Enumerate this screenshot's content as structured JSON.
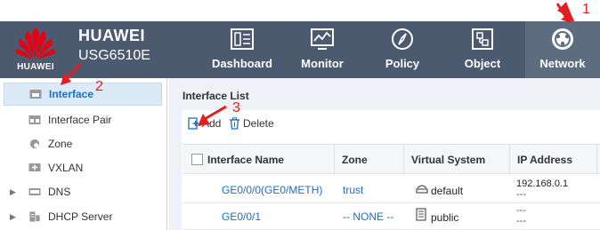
{
  "header": {
    "logo_text": "HUAWEI",
    "brand": "HUAWEI",
    "model": "USG6510E",
    "nav": [
      {
        "label": "Dashboard",
        "icon": "dashboard-icon"
      },
      {
        "label": "Monitor",
        "icon": "monitor-icon"
      },
      {
        "label": "Policy",
        "icon": "compass-icon"
      },
      {
        "label": "Object",
        "icon": "object-icon"
      },
      {
        "label": "Network",
        "icon": "globe-icon",
        "active": true
      }
    ]
  },
  "sidebar": {
    "items": [
      {
        "label": "Interface",
        "icon": "interface-icon",
        "active": true
      },
      {
        "label": "Interface Pair",
        "icon": "interface-pair-icon"
      },
      {
        "label": "Zone",
        "icon": "zone-icon"
      },
      {
        "label": "VXLAN",
        "icon": "vxlan-icon"
      },
      {
        "label": "DNS",
        "icon": "dns-icon",
        "expandable": true
      },
      {
        "label": "DHCP Server",
        "icon": "dhcp-icon",
        "expandable": true
      }
    ]
  },
  "main": {
    "title": "Interface List",
    "toolbar": {
      "add_label": "Add",
      "delete_label": "Delete"
    },
    "columns": [
      "Interface Name",
      "Zone",
      "Virtual System",
      "IP Address"
    ],
    "rows": [
      {
        "name": "GE0/0/0(GE0/METH)",
        "zone": "trust",
        "vsys": "default",
        "ip1": "192.168.0.1",
        "ip2": "---"
      },
      {
        "name": "GE0/0/1",
        "zone": "-- NONE --",
        "vsys": "public",
        "ip1": "---",
        "ip2": "---"
      }
    ]
  },
  "annotations": [
    "1",
    "2",
    "3"
  ],
  "colors": {
    "header_bg": "#4b5a6e",
    "accent_blue": "#1e6fc4",
    "annotation_red": "#e02020"
  }
}
